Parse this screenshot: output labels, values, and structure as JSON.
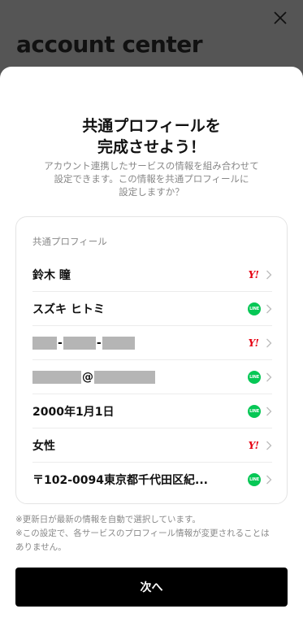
{
  "header": {
    "brand": "account center"
  },
  "sheet": {
    "title_line1": "共通プロフィールを",
    "title_line2": "完成させよう！",
    "desc_line1": "アカウント連携したサービスの情報を組み合わせて",
    "desc_line2": "設定できます。この情報を共通プロフィールに",
    "desc_line3": "設定しますか？",
    "card_label": "共通プロフィール",
    "rows": [
      {
        "value": "鈴木 瞳",
        "source": "Y!"
      },
      {
        "value": "スズキ ヒトミ",
        "source": "LINE"
      },
      {
        "value": "",
        "source": "Y!",
        "masked": "phone",
        "sep": "-"
      },
      {
        "value": "",
        "source": "LINE",
        "masked": "email",
        "sep": "@"
      },
      {
        "value": "2000年1月1日",
        "source": "LINE"
      },
      {
        "value": "女性",
        "source": "Y!"
      },
      {
        "value": "〒102-0094東京都千代田区紀...",
        "source": "LINE"
      }
    ],
    "note1": "※更新日が最新の情報を自動で選択しています。",
    "note2": "※この設定で、各サービスのプロフィール情報が変更されることは",
    "note3": "ありません。",
    "next_label": "次へ"
  },
  "icons": {
    "yahoo_mark": "Y!",
    "line_mark": "LINE",
    "yahoo_color": "#e60012",
    "line_color": "#06c755"
  }
}
